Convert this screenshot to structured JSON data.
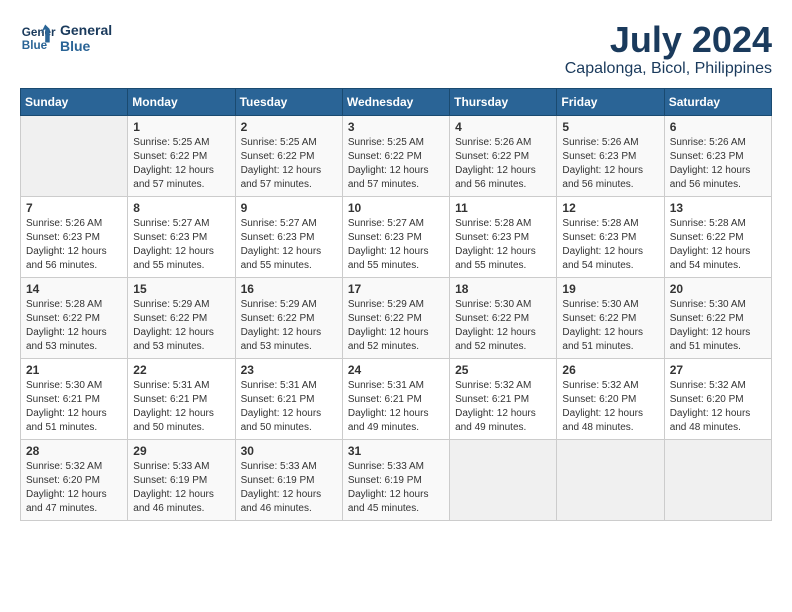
{
  "header": {
    "logo_line1": "General",
    "logo_line2": "Blue",
    "month_year": "July 2024",
    "location": "Capalonga, Bicol, Philippines"
  },
  "weekdays": [
    "Sunday",
    "Monday",
    "Tuesday",
    "Wednesday",
    "Thursday",
    "Friday",
    "Saturday"
  ],
  "weeks": [
    [
      {
        "day": "",
        "info": ""
      },
      {
        "day": "1",
        "info": "Sunrise: 5:25 AM\nSunset: 6:22 PM\nDaylight: 12 hours\nand 57 minutes."
      },
      {
        "day": "2",
        "info": "Sunrise: 5:25 AM\nSunset: 6:22 PM\nDaylight: 12 hours\nand 57 minutes."
      },
      {
        "day": "3",
        "info": "Sunrise: 5:25 AM\nSunset: 6:22 PM\nDaylight: 12 hours\nand 57 minutes."
      },
      {
        "day": "4",
        "info": "Sunrise: 5:26 AM\nSunset: 6:22 PM\nDaylight: 12 hours\nand 56 minutes."
      },
      {
        "day": "5",
        "info": "Sunrise: 5:26 AM\nSunset: 6:23 PM\nDaylight: 12 hours\nand 56 minutes."
      },
      {
        "day": "6",
        "info": "Sunrise: 5:26 AM\nSunset: 6:23 PM\nDaylight: 12 hours\nand 56 minutes."
      }
    ],
    [
      {
        "day": "7",
        "info": "Sunrise: 5:26 AM\nSunset: 6:23 PM\nDaylight: 12 hours\nand 56 minutes."
      },
      {
        "day": "8",
        "info": "Sunrise: 5:27 AM\nSunset: 6:23 PM\nDaylight: 12 hours\nand 55 minutes."
      },
      {
        "day": "9",
        "info": "Sunrise: 5:27 AM\nSunset: 6:23 PM\nDaylight: 12 hours\nand 55 minutes."
      },
      {
        "day": "10",
        "info": "Sunrise: 5:27 AM\nSunset: 6:23 PM\nDaylight: 12 hours\nand 55 minutes."
      },
      {
        "day": "11",
        "info": "Sunrise: 5:28 AM\nSunset: 6:23 PM\nDaylight: 12 hours\nand 55 minutes."
      },
      {
        "day": "12",
        "info": "Sunrise: 5:28 AM\nSunset: 6:23 PM\nDaylight: 12 hours\nand 54 minutes."
      },
      {
        "day": "13",
        "info": "Sunrise: 5:28 AM\nSunset: 6:22 PM\nDaylight: 12 hours\nand 54 minutes."
      }
    ],
    [
      {
        "day": "14",
        "info": "Sunrise: 5:28 AM\nSunset: 6:22 PM\nDaylight: 12 hours\nand 53 minutes."
      },
      {
        "day": "15",
        "info": "Sunrise: 5:29 AM\nSunset: 6:22 PM\nDaylight: 12 hours\nand 53 minutes."
      },
      {
        "day": "16",
        "info": "Sunrise: 5:29 AM\nSunset: 6:22 PM\nDaylight: 12 hours\nand 53 minutes."
      },
      {
        "day": "17",
        "info": "Sunrise: 5:29 AM\nSunset: 6:22 PM\nDaylight: 12 hours\nand 52 minutes."
      },
      {
        "day": "18",
        "info": "Sunrise: 5:30 AM\nSunset: 6:22 PM\nDaylight: 12 hours\nand 52 minutes."
      },
      {
        "day": "19",
        "info": "Sunrise: 5:30 AM\nSunset: 6:22 PM\nDaylight: 12 hours\nand 51 minutes."
      },
      {
        "day": "20",
        "info": "Sunrise: 5:30 AM\nSunset: 6:22 PM\nDaylight: 12 hours\nand 51 minutes."
      }
    ],
    [
      {
        "day": "21",
        "info": "Sunrise: 5:30 AM\nSunset: 6:21 PM\nDaylight: 12 hours\nand 51 minutes."
      },
      {
        "day": "22",
        "info": "Sunrise: 5:31 AM\nSunset: 6:21 PM\nDaylight: 12 hours\nand 50 minutes."
      },
      {
        "day": "23",
        "info": "Sunrise: 5:31 AM\nSunset: 6:21 PM\nDaylight: 12 hours\nand 50 minutes."
      },
      {
        "day": "24",
        "info": "Sunrise: 5:31 AM\nSunset: 6:21 PM\nDaylight: 12 hours\nand 49 minutes."
      },
      {
        "day": "25",
        "info": "Sunrise: 5:32 AM\nSunset: 6:21 PM\nDaylight: 12 hours\nand 49 minutes."
      },
      {
        "day": "26",
        "info": "Sunrise: 5:32 AM\nSunset: 6:20 PM\nDaylight: 12 hours\nand 48 minutes."
      },
      {
        "day": "27",
        "info": "Sunrise: 5:32 AM\nSunset: 6:20 PM\nDaylight: 12 hours\nand 48 minutes."
      }
    ],
    [
      {
        "day": "28",
        "info": "Sunrise: 5:32 AM\nSunset: 6:20 PM\nDaylight: 12 hours\nand 47 minutes."
      },
      {
        "day": "29",
        "info": "Sunrise: 5:33 AM\nSunset: 6:19 PM\nDaylight: 12 hours\nand 46 minutes."
      },
      {
        "day": "30",
        "info": "Sunrise: 5:33 AM\nSunset: 6:19 PM\nDaylight: 12 hours\nand 46 minutes."
      },
      {
        "day": "31",
        "info": "Sunrise: 5:33 AM\nSunset: 6:19 PM\nDaylight: 12 hours\nand 45 minutes."
      },
      {
        "day": "",
        "info": ""
      },
      {
        "day": "",
        "info": ""
      },
      {
        "day": "",
        "info": ""
      }
    ]
  ]
}
